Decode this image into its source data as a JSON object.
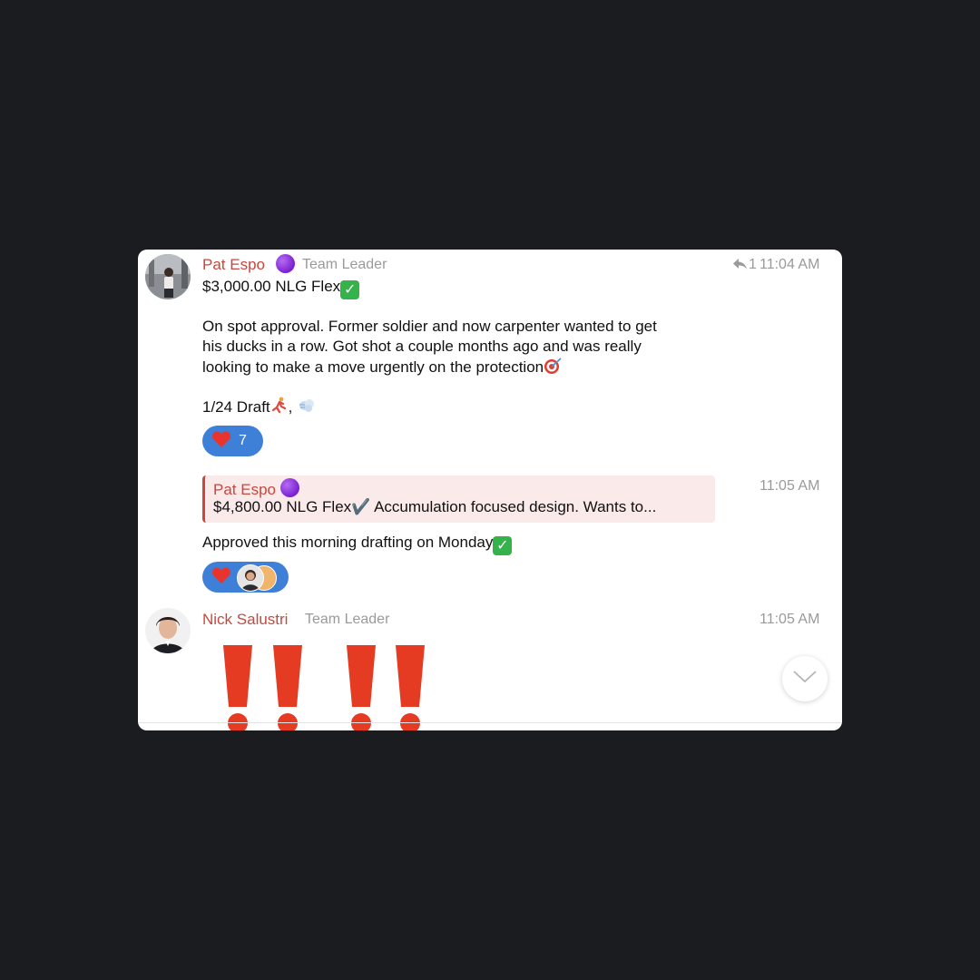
{
  "messages": [
    {
      "sender": "Pat Espo",
      "role": "Team Leader",
      "reply_count": "1",
      "time": "11:04 AM",
      "title": "$3,000.00 NLG Flex",
      "body_line1": "On spot approval. Former soldier and now carpenter wanted to get",
      "body_line2": "his ducks in a row. Got shot a couple months ago and was really",
      "body_line3": "looking to make a move urgently on the protection",
      "draft_line": "1/24 Draft",
      "reaction_count": "7"
    },
    {
      "time": "11:05 AM",
      "quote_sender": "Pat Espo",
      "quote_text": "$4,800.00 NLG Flex✔️  Accumulation focused design. Wants to...",
      "text": "Approved this morning drafting on Monday"
    },
    {
      "sender": "Nick Salustri",
      "role": "Team Leader",
      "time": "11:05 AM"
    }
  ],
  "colors": {
    "sender": "#c9473d",
    "reaction_bg": "#3e7fd8",
    "quote_bg": "#fbeaea",
    "background": "#1b1c1f"
  },
  "icons": [
    "reply-arrow-icon",
    "heart-icon",
    "check-mark-icon",
    "purple-circle-icon",
    "chevron-down-icon",
    "exclamation-icon"
  ]
}
